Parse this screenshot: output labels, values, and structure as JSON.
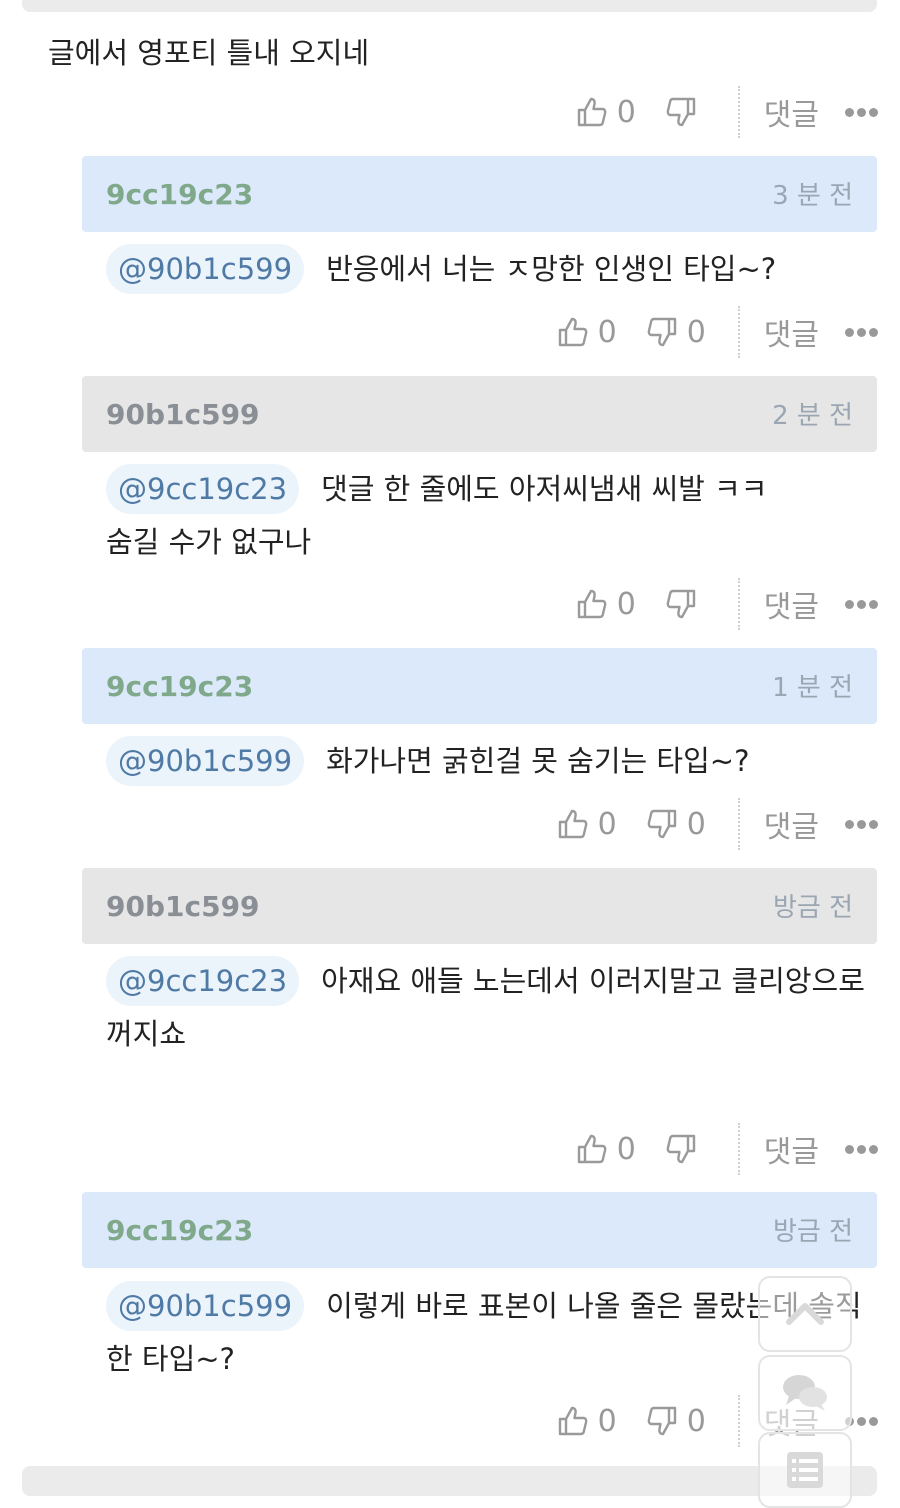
{
  "first_comment": {
    "text": "글에서 영포티 틀내 오지네"
  },
  "actions": {
    "reply_label": "댓글"
  },
  "rows": [
    {
      "like": "0",
      "dislike": ""
    },
    {
      "like": "0",
      "dislike": "0"
    },
    {
      "like": "0",
      "dislike": ""
    },
    {
      "like": "0",
      "dislike": "0"
    },
    {
      "like": "0",
      "dislike": ""
    },
    {
      "like": "0",
      "dislike": "0"
    }
  ],
  "replies": [
    {
      "author": "9cc19c23",
      "time": "3 분 전",
      "mention": "@90b1c599",
      "text": "반응에서 너는 ㅈ망한 인생인 타입~?"
    },
    {
      "author": "90b1c599",
      "time": "2 분 전",
      "mention": "@9cc19c23",
      "text": "댓글 한 줄에도 아저씨냄새 씨발 ㅋㅋ 숨길 수가 없구나"
    },
    {
      "author": "9cc19c23",
      "time": "1 분 전",
      "mention": "@90b1c599",
      "text": "화가나면 굵힌걸 못 숨기는 타입~?"
    },
    {
      "author": "90b1c599",
      "time": "방금 전",
      "mention": "@9cc19c23",
      "text": "아재요 애들 노는데서 이러지말고 클리앙으로 꺼지쇼"
    },
    {
      "author": "9cc19c23",
      "time": "방금 전",
      "mention": "@90b1c599",
      "text": "이렇게 바로 표본이 나올 줄은 몰랐는데 솔직한 타입~?"
    }
  ],
  "floating": {
    "up_icon": "chevron-up-icon",
    "comment_icon": "chat-bubbles-icon",
    "list_icon": "list-icon"
  }
}
